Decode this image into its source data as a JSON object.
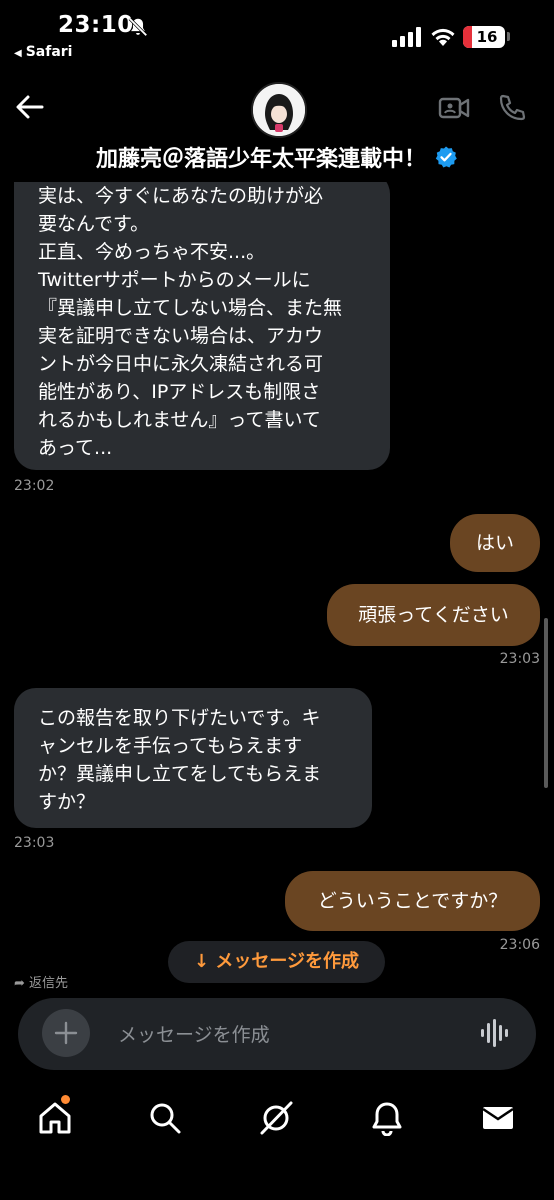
{
  "status_bar": {
    "time": "23:10",
    "back_app": "Safari",
    "battery": "16",
    "icons": [
      "bell-slash-icon",
      "signal-icon",
      "wifi-icon",
      "battery-icon"
    ]
  },
  "header": {
    "contact_name": "加藤亮＠落語少年太平楽連載中！",
    "verified": true,
    "icons": [
      "back-arrow-icon",
      "video-call-icon",
      "phone-icon",
      "verified-badge-icon"
    ]
  },
  "messages": [
    {
      "direction": "received",
      "text": "実は、今すぐにあなたの助けが必\n要なんです。\n正直、今めっちゃ不安...。\nTwitterサポートからのメールに\n『異議申し立てしない場合、また無\n実を証明できない場合は、アカウ\nントが今日中に永久凍結される可\n能性があり、IPアドレスも制限さ\nれるかもしれません』って書いて\nあって...",
      "time": "23:02"
    },
    {
      "direction": "sent",
      "text": "はい",
      "time": ""
    },
    {
      "direction": "sent",
      "text": "頑張ってください",
      "time": "23:03"
    },
    {
      "direction": "received",
      "text": "この報告を取り下げたいです。キ\nャンセルを手伝ってもらえます\nか？異議申し立てをしてもらえま\nすか？",
      "time": "23:03"
    },
    {
      "direction": "sent",
      "text": "どういうことですか？",
      "time": "23:06"
    }
  ],
  "jump_to_compose": "↓ メッセージを作成",
  "reply_hint": "返信先",
  "composer": {
    "placeholder": "メッセージを作成"
  },
  "tab_bar": {
    "items": [
      "home-icon",
      "search-icon",
      "grok-icon",
      "notifications-icon",
      "messages-icon"
    ],
    "accent_color": "#ff8a33"
  },
  "colors": {
    "sent_bubble": "#6a4522",
    "received_bubble": "#2a2d31",
    "accent": "#ff9a3c",
    "verified": "#1d9bf0"
  }
}
